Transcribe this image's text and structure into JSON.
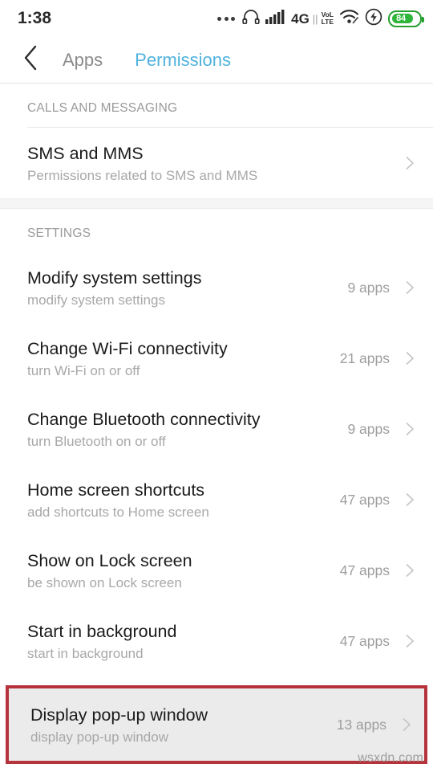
{
  "status_bar": {
    "time": "1:38",
    "icons": [
      "more-dots",
      "headset",
      "signal-bars",
      "network-4g",
      "volte",
      "wifi",
      "flash",
      "battery"
    ],
    "network_label": "4G",
    "volte_top": "VoL",
    "volte_bottom": "LTE",
    "battery_level": "84"
  },
  "appbar": {
    "back_icon": "chevron-left-icon",
    "tabs": [
      {
        "label": "Apps",
        "active": false
      },
      {
        "label": "Permissions",
        "active": true
      }
    ]
  },
  "colors": {
    "accent": "#4fb2dd",
    "highlight_border": "#b5343c",
    "highlight_bg": "#ebebeb",
    "battery_green": "#2fb539"
  },
  "sections": [
    {
      "header": "CALLS AND MESSAGING",
      "rows": [
        {
          "title": "SMS and MMS",
          "subtitle": "Permissions related to SMS and MMS",
          "count": "",
          "highlighted": false
        }
      ]
    },
    {
      "header": "SETTINGS",
      "rows": [
        {
          "title": "Modify system settings",
          "subtitle": "modify system settings",
          "count": "9 apps",
          "highlighted": false
        },
        {
          "title": "Change Wi-Fi connectivity",
          "subtitle": "turn Wi-Fi on or off",
          "count": "21 apps",
          "highlighted": false
        },
        {
          "title": "Change Bluetooth connectivity",
          "subtitle": "turn Bluetooth on or off",
          "count": "9 apps",
          "highlighted": false
        },
        {
          "title": "Home screen shortcuts",
          "subtitle": "add shortcuts to Home screen",
          "count": "47 apps",
          "highlighted": false
        },
        {
          "title": "Show on Lock screen",
          "subtitle": "be shown on Lock screen",
          "count": "47 apps",
          "highlighted": false
        },
        {
          "title": "Start in background",
          "subtitle": "start in background",
          "count": "47 apps",
          "highlighted": false
        },
        {
          "title": "Display pop-up window",
          "subtitle": "display pop-up window",
          "count": "13 apps",
          "highlighted": true
        }
      ]
    }
  ],
  "watermark": "wsxdn.com"
}
